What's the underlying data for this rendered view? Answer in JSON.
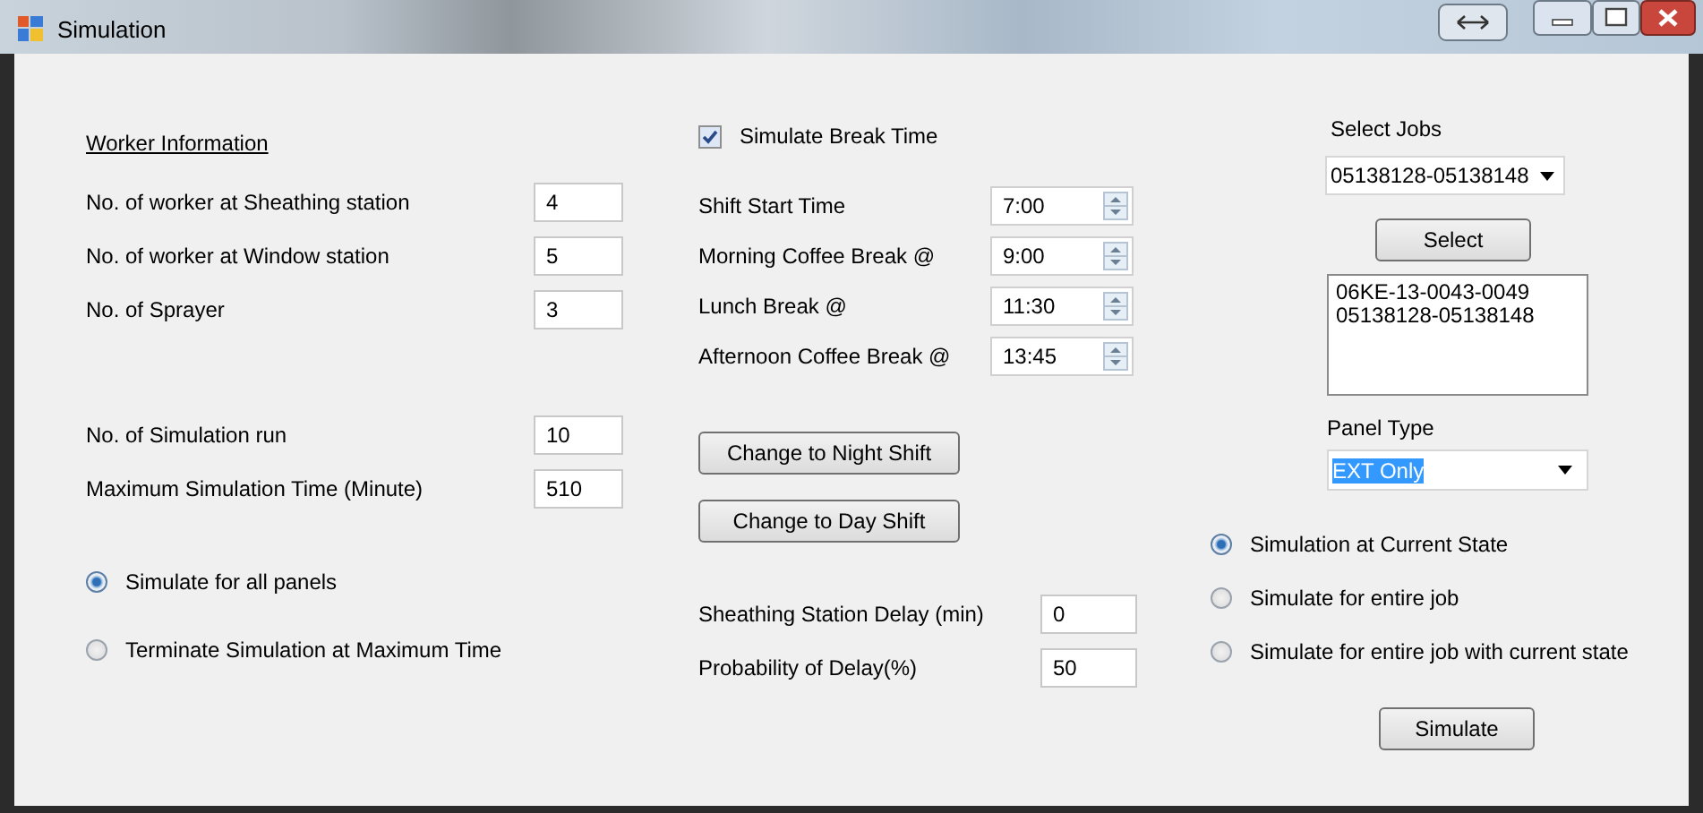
{
  "window": {
    "title": "Simulation"
  },
  "worker_information": {
    "heading": "Worker Information",
    "fields": [
      {
        "label": "No. of worker at Sheathing station",
        "value": "4"
      },
      {
        "label": "No. of worker at Window station",
        "value": "5"
      },
      {
        "label": "No. of Sprayer",
        "value": "3"
      }
    ]
  },
  "simulation_fields": [
    {
      "label": "No. of Simulation run",
      "value": "10"
    },
    {
      "label": "Maximum Simulation Time (Minute)",
      "value": "510"
    }
  ],
  "panel_options": [
    {
      "label": "Simulate for all panels",
      "selected": true
    },
    {
      "label": "Terminate Simulation at Maximum Time",
      "selected": false
    }
  ],
  "break_time": {
    "checkbox": {
      "label": "Simulate Break Time",
      "checked": true
    },
    "times": [
      {
        "label": "Shift Start Time",
        "value": "7:00"
      },
      {
        "label": "Morning Coffee Break @",
        "value": "9:00"
      },
      {
        "label": "Lunch Break @",
        "value": "11:30"
      },
      {
        "label": "Afternoon Coffee Break @",
        "value": "13:45"
      }
    ]
  },
  "shift_buttons": [
    "Change to Night Shift",
    "Change to Day Shift"
  ],
  "delay_fields": [
    {
      "label": "Sheathing Station Delay (min)",
      "value": "0"
    },
    {
      "label": "Probability of Delay(%)",
      "value": "50"
    }
  ],
  "jobs": {
    "label": "Select Jobs",
    "combo_value": "05138128-05138148",
    "select_button": "Select",
    "list_items": [
      "06KE-13-0043-0049",
      "05138128-05138148"
    ],
    "panel_type_label": "Panel Type",
    "panel_type_value": "EXT Only",
    "panel_type_text_selected": true
  },
  "scope_options": [
    {
      "label": "Simulation at Current State",
      "selected": true
    },
    {
      "label": "Simulate for entire job",
      "selected": false
    },
    {
      "label": "Simulate for entire job with current state",
      "selected": false
    }
  ],
  "simulate_button": "Simulate"
}
